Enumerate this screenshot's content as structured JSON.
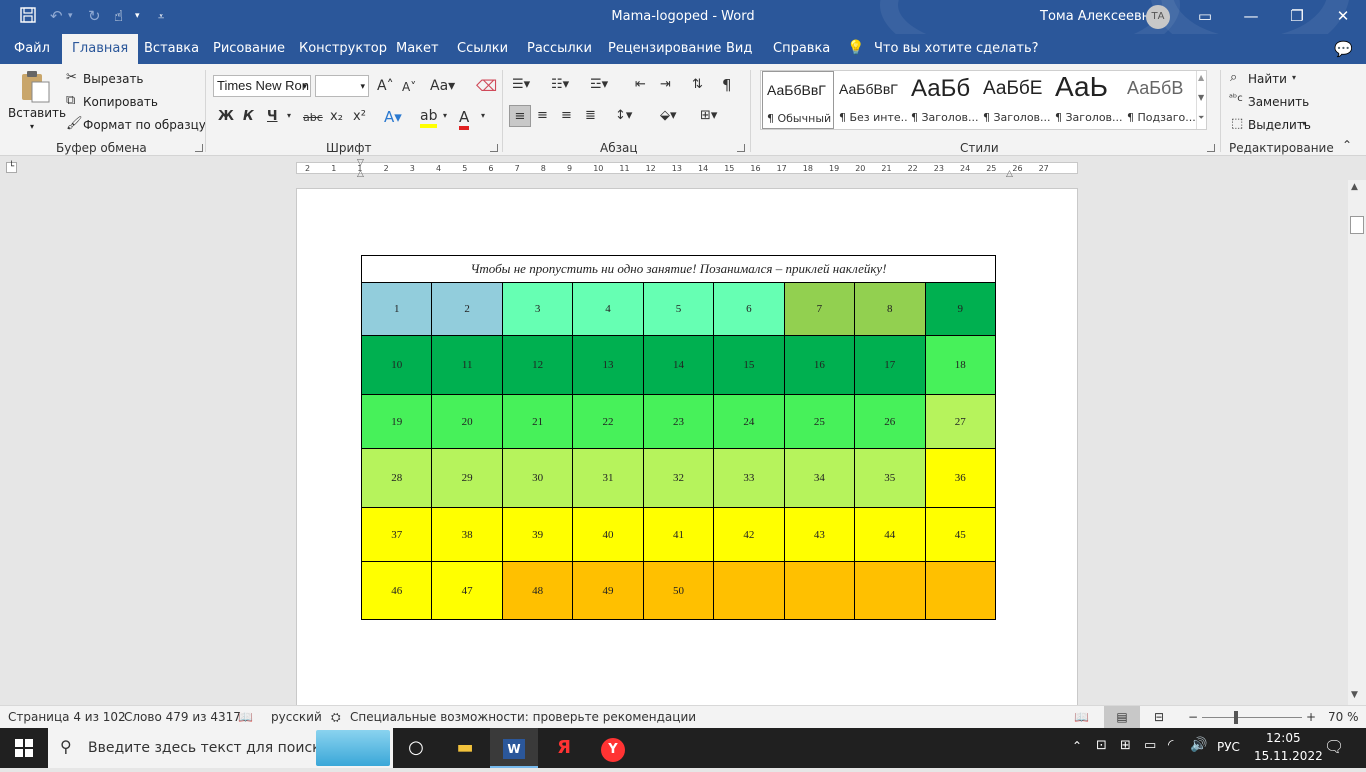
{
  "window": {
    "doc_title": "Mama-logoped  -  Word",
    "user_name": "Тома Алексеевна",
    "user_initials": "ТА"
  },
  "tabs": [
    "Файл",
    "Главная",
    "Вставка",
    "Рисование",
    "Конструктор",
    "Макет",
    "Ссылки",
    "Рассылки",
    "Рецензирование",
    "Вид",
    "Справка"
  ],
  "active_tab": "Главная",
  "tell_me": "Что вы хотите сделать?",
  "ribbon": {
    "clipboard": {
      "paste": "Вставить",
      "cut": "Вырезать",
      "copy": "Копировать",
      "format_painter": "Формат по образцу",
      "label": "Буфер обмена"
    },
    "font": {
      "font_name": "Times New Ron",
      "font_size": "",
      "bold": "Ж",
      "italic": "К",
      "underline": "Ч",
      "strike": "abc",
      "subscript": "x₂",
      "superscript": "x²",
      "label": "Шрифт"
    },
    "paragraph": {
      "label": "Абзац"
    },
    "styles": {
      "label": "Стили",
      "items": [
        {
          "preview": "АаБбВвГ",
          "name": "¶ Обычный"
        },
        {
          "preview": "АаБбВвГ",
          "name": "¶ Без инте..."
        },
        {
          "preview": "АаБб",
          "name": "¶ Заголов..."
        },
        {
          "preview": "АаБбЕ",
          "name": "¶ Заголов..."
        },
        {
          "preview": "АаЬ",
          "name": "¶ Заголов..."
        },
        {
          "preview": "АаБбВ",
          "name": "¶ Подзаго..."
        }
      ]
    },
    "editing": {
      "find": "Найти",
      "replace": "Заменить",
      "select": "Выделить",
      "label": "Редактирование"
    }
  },
  "ruler_ticks": [
    "2",
    "1",
    "1",
    "2",
    "3",
    "4",
    "5",
    "6",
    "7",
    "8",
    "9",
    "10",
    "11",
    "12",
    "13",
    "14",
    "15",
    "16",
    "17",
    "18",
    "19",
    "20",
    "21",
    "22",
    "23",
    "24",
    "25",
    "26",
    "27"
  ],
  "document": {
    "table_header": "Чтобы не пропустить ни одно занятие! Позанимался – приклей наклейку!",
    "rows": [
      [
        "1",
        "2",
        "3",
        "4",
        "5",
        "6",
        "7",
        "8",
        "9"
      ],
      [
        "10",
        "11",
        "12",
        "13",
        "14",
        "15",
        "16",
        "17",
        "18"
      ],
      [
        "19",
        "20",
        "21",
        "22",
        "23",
        "24",
        "25",
        "26",
        "27"
      ],
      [
        "28",
        "29",
        "30",
        "31",
        "32",
        "33",
        "34",
        "35",
        "36"
      ],
      [
        "37",
        "38",
        "39",
        "40",
        "41",
        "42",
        "43",
        "44",
        "45"
      ],
      [
        "46",
        "47",
        "48",
        "49",
        "50",
        "",
        "",
        "",
        ""
      ]
    ],
    "row_colors": [
      [
        "#92cddc",
        "#92cddc",
        "#66ffb3",
        "#66ffb3",
        "#66ffb3",
        "#66ffb3",
        "#92d050",
        "#92d050",
        "#00b050"
      ],
      [
        "#00b050",
        "#00b050",
        "#00b050",
        "#00b050",
        "#00b050",
        "#00b050",
        "#00b050",
        "#00b050",
        "#47f15a"
      ],
      [
        "#47f15a",
        "#47f15a",
        "#47f15a",
        "#47f15a",
        "#47f15a",
        "#47f15a",
        "#47f15a",
        "#47f15a",
        "#b6f35c"
      ],
      [
        "#b6f35c",
        "#b6f35c",
        "#b6f35c",
        "#b6f35c",
        "#b6f35c",
        "#b6f35c",
        "#b6f35c",
        "#b6f35c",
        "#ffff00"
      ],
      [
        "#ffff00",
        "#ffff00",
        "#ffff00",
        "#ffff00",
        "#ffff00",
        "#ffff00",
        "#ffff00",
        "#ffff00",
        "#ffff00"
      ],
      [
        "#ffff00",
        "#ffff00",
        "#ffc000",
        "#ffc000",
        "#ffc000",
        "#ffc000",
        "#ffc000",
        "#ffc000",
        "#ffc000"
      ]
    ]
  },
  "status": {
    "page": "Страница 4 из 102",
    "words": "Слово 479 из 4317",
    "language": "русский",
    "accessibility": "Специальные возможности: проверьте рекомендации",
    "zoom": "70 %"
  },
  "taskbar": {
    "search_placeholder": "Введите здесь текст для поиска",
    "lang": "РУС",
    "time": "12:05",
    "date": "15.11.2022"
  },
  "colors": {
    "word_blue": "#2b579a",
    "ribbon_bg": "#f3f3f3",
    "taskbar": "#202020"
  }
}
